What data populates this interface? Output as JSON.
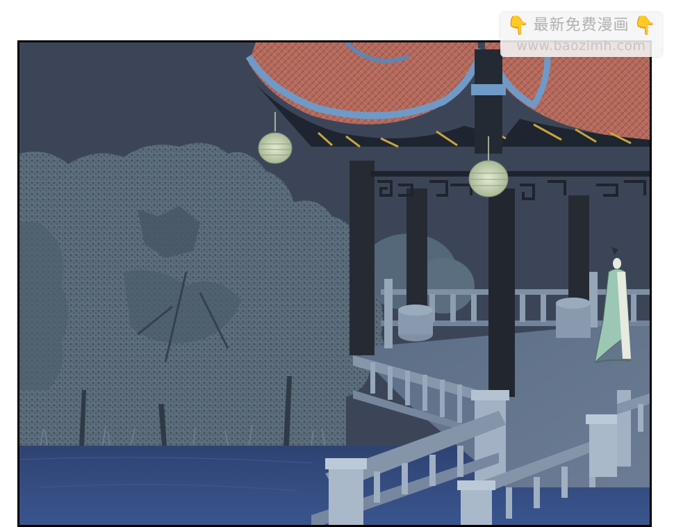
{
  "watermark": {
    "title": "最新免费漫画",
    "url": "www.baozimh.com",
    "icon_left": "pointing-down-hand-icon",
    "icon_right": "pointing-down-hand-icon",
    "icon_color": "#f4b324"
  },
  "scene": {
    "sky_color": "#3a4356",
    "water_color": "#364e82",
    "roof_tile_color": "#b46a5c",
    "trim_color": "#6f9ac8",
    "figure_robe_color": "#9cc7b4"
  }
}
